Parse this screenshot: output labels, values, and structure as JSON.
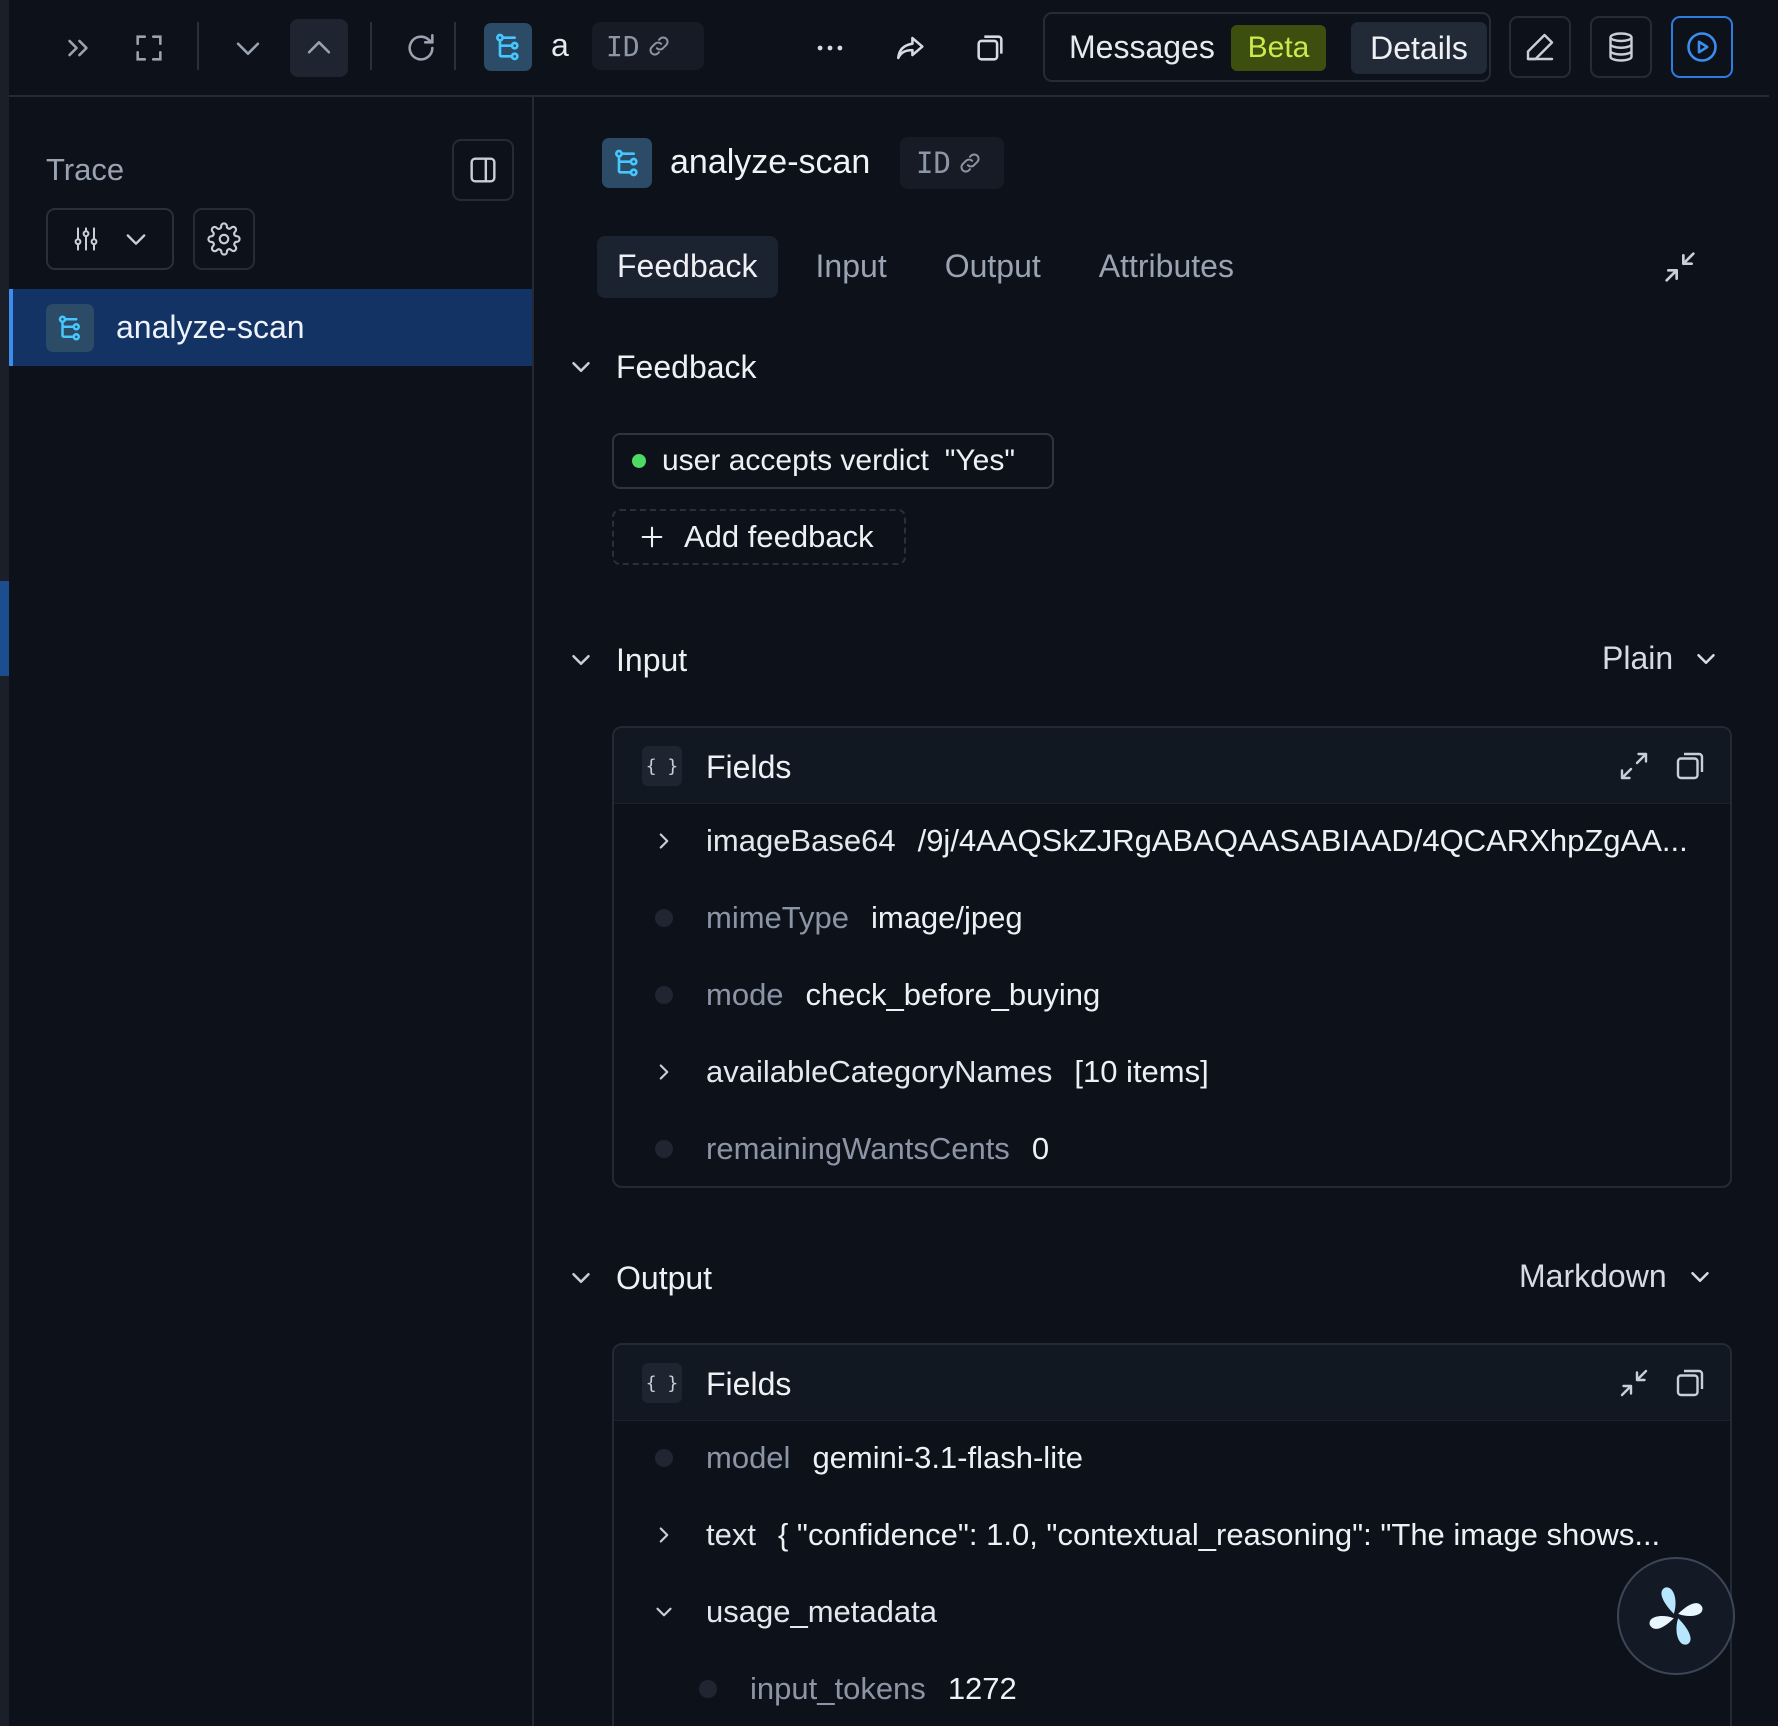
{
  "toolbar": {
    "span_name_truncated": "a",
    "id_label": "ID",
    "messages_label": "Messages",
    "beta_label": "Beta",
    "details_label": "Details",
    "icons": [
      "expand-right-icon",
      "fullscreen-icon",
      "chevron-down-icon",
      "chevron-up-icon",
      "refresh-icon",
      "more-icon",
      "share-icon",
      "copy-icon",
      "edit-icon",
      "database-icon",
      "play-icon"
    ]
  },
  "trace_panel": {
    "title": "Trace",
    "tree": [
      {
        "label": "analyze-scan",
        "selected": true
      }
    ]
  },
  "span": {
    "title": "analyze-scan",
    "id_label": "ID",
    "tabs": [
      "Feedback",
      "Input",
      "Output",
      "Attributes"
    ],
    "active_tab": "Feedback"
  },
  "feedback": {
    "title": "Feedback",
    "items": [
      {
        "name": "user accepts verdict",
        "value": "\"Yes\"",
        "color": "#4cd964"
      }
    ],
    "add_label": "Add feedback"
  },
  "input": {
    "title": "Input",
    "format": "Plain",
    "fields_title": "Fields",
    "rows": [
      {
        "key": "imageBase64",
        "value": "/9j/4AAQSkZJRgABAQAASABIAAD/4QCARXhpZgAA...",
        "expandable": true
      },
      {
        "key": "mimeType",
        "value": "image/jpeg",
        "expandable": false
      },
      {
        "key": "mode",
        "value": "check_before_buying",
        "expandable": false
      },
      {
        "key": "availableCategoryNames",
        "value": "[10 items]",
        "expandable": true
      },
      {
        "key": "remainingWantsCents",
        "value": "0",
        "expandable": false
      }
    ]
  },
  "output": {
    "title": "Output",
    "format": "Markdown",
    "fields_title": "Fields",
    "rows": [
      {
        "key": "model",
        "value": "gemini-3.1-flash-lite",
        "expandable": false
      },
      {
        "key": "text",
        "value": "{ \"confidence\": 1.0, \"contextual_reasoning\": \"The image shows...",
        "expandable": true
      },
      {
        "key": "usage_metadata",
        "value": "",
        "expandable": true,
        "expanded": true
      },
      {
        "key": "input_tokens",
        "value": "1272",
        "expandable": false,
        "nested": true
      }
    ]
  },
  "colors": {
    "accent": "#3c8df0",
    "selected_row": "#123364",
    "beta_bg": "#3c4f0e",
    "beta_fg": "#cbe94c",
    "span_icon": "#46c7ff"
  }
}
